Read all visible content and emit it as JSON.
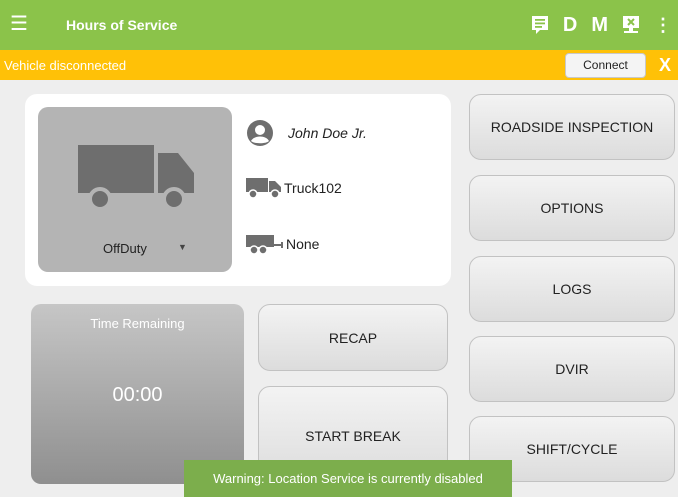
{
  "header": {
    "title": "Hours of Service",
    "menu_icon": "hamburger-menu-icon",
    "actions": [
      "D",
      "M"
    ],
    "more_icon": "more-vertical-icon"
  },
  "alert": {
    "message": "Vehicle disconnected",
    "connect_label": "Connect",
    "close_label": "X"
  },
  "driver": {
    "name": "John Doe Jr.",
    "vehicle": "Truck102",
    "trailer": "None",
    "duty_status": "OffDuty"
  },
  "time_remaining": {
    "title": "Time Remaining",
    "value": "00:00"
  },
  "buttons": {
    "recap": "RECAP",
    "start_break": "START BREAK",
    "roadside": "ROADSIDE INSPECTION",
    "options": "OPTIONS",
    "logs": "LOGS",
    "dvir": "DVIR",
    "shift_cycle": "SHIFT/CYCLE"
  },
  "toast": {
    "message": "Warning: Location Service is currently disabled"
  },
  "colors": {
    "header": "#8bc34a",
    "alert": "#ffc107",
    "toast": "#7cae4c",
    "tile": "#b4b4b4"
  }
}
